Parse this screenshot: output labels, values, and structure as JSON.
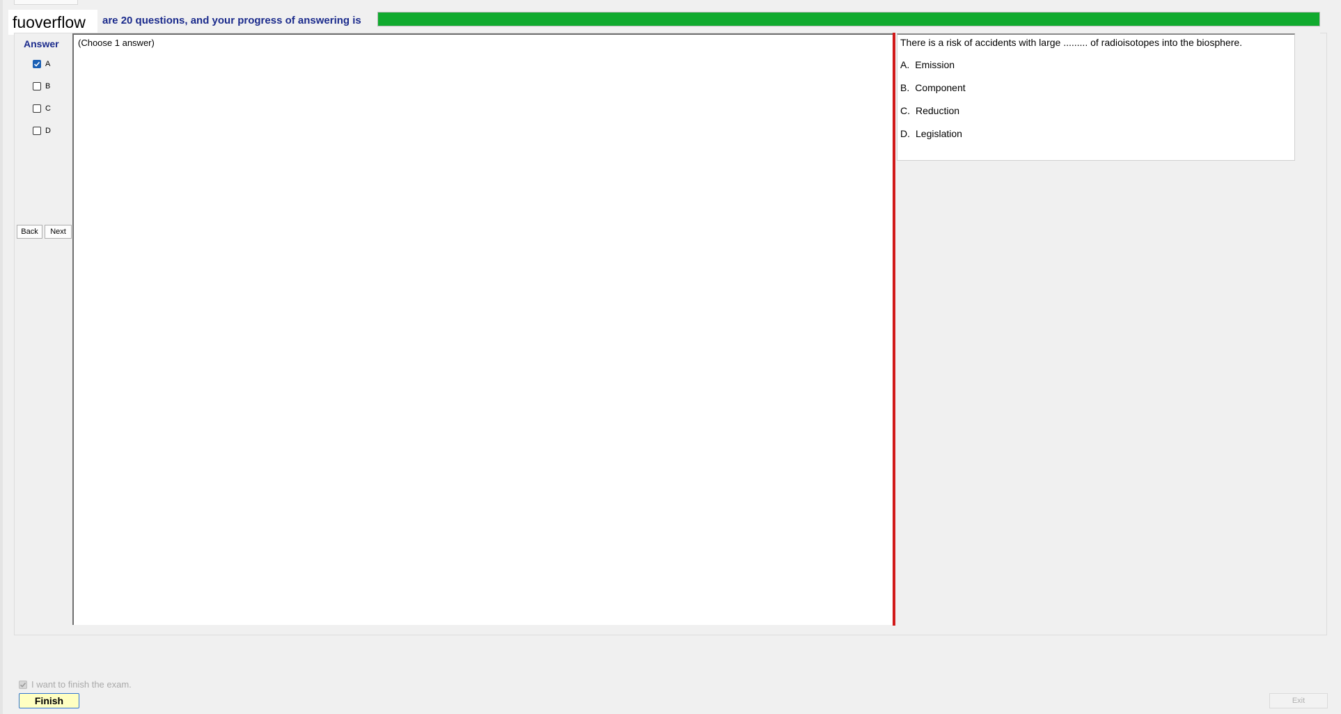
{
  "header": {
    "brand": "fuoverflow",
    "progress_text": "are 20 questions, and your progress of answering is",
    "progress_value": 1.0,
    "progress_color": "#10aa2e"
  },
  "answer_panel": {
    "title": "Answer",
    "options": [
      {
        "label": "A",
        "checked": true
      },
      {
        "label": "B",
        "checked": false
      },
      {
        "label": "C",
        "checked": false
      },
      {
        "label": "D",
        "checked": false
      }
    ],
    "back_label": "Back",
    "next_label": "Next"
  },
  "choose_pane": {
    "instruction": "(Choose 1 answer)"
  },
  "question": {
    "text": "There is a risk of accidents with large ......... of radioisotopes into the biosphere.",
    "options": [
      {
        "letter": "A.",
        "text": "Emission"
      },
      {
        "letter": "B.",
        "text": "Component"
      },
      {
        "letter": "C.",
        "text": "Reduction"
      },
      {
        "letter": "D.",
        "text": "Legislation"
      }
    ]
  },
  "footer": {
    "finish_check_label": "I want to finish the exam.",
    "finish_check_checked": true,
    "finish_label": "Finish",
    "exit_label": "Exit"
  },
  "colors": {
    "divider": "#d11a1a",
    "title_blue": "#1b2b8c",
    "finish_bg": "#ffffc2"
  }
}
